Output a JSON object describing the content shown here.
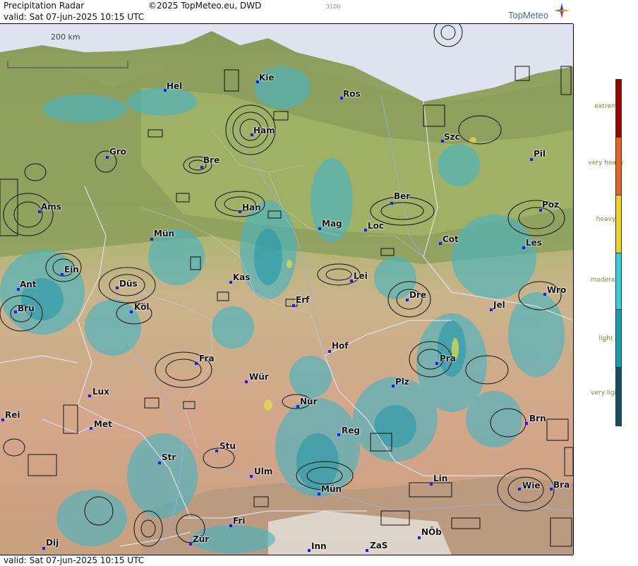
{
  "header": {
    "title": "Precipitation Radar",
    "copyright": "©2025 TopMeteo.eu, DWD",
    "small_code": "3100",
    "valid": "valid:  Sat  07-jun-2025 10:15 UTC",
    "logo": "TopMeteo",
    "compass_icon": "compass-rose-icon"
  },
  "footer": {
    "valid": "valid:  Sat  07-jun-2025 10:15 UTC"
  },
  "scale_bar": {
    "label": "200 km"
  },
  "legend": {
    "items": [
      {
        "label": "extrem",
        "color": "#a00000"
      },
      {
        "label": "very heavy",
        "color": "#e8641e"
      },
      {
        "label": "heavy",
        "color": "#f0d21e"
      },
      {
        "label": "moderate",
        "color": "#32d2dc"
      },
      {
        "label": "light",
        "color": "#14a0b4"
      },
      {
        "label": "very light",
        "color": "#145064"
      }
    ]
  },
  "cities": [
    {
      "name": "Hel"
    },
    {
      "name": "Kie"
    },
    {
      "name": "Ros"
    },
    {
      "name": "Ham"
    },
    {
      "name": "Szc"
    },
    {
      "name": "Gro"
    },
    {
      "name": "Bre"
    },
    {
      "name": "Pil"
    },
    {
      "name": "Ams"
    },
    {
      "name": "Han"
    },
    {
      "name": "Ber"
    },
    {
      "name": "Poz"
    },
    {
      "name": "Mün"
    },
    {
      "name": "Mag"
    },
    {
      "name": "Loc"
    },
    {
      "name": "Cot"
    },
    {
      "name": "Les"
    },
    {
      "name": "Ein"
    },
    {
      "name": "Kas"
    },
    {
      "name": "Lei"
    },
    {
      "name": "Ant"
    },
    {
      "name": "Düs"
    },
    {
      "name": "Dre"
    },
    {
      "name": "Wro"
    },
    {
      "name": "Bru"
    },
    {
      "name": "Köl"
    },
    {
      "name": "Erf"
    },
    {
      "name": "Jel"
    },
    {
      "name": "Hof"
    },
    {
      "name": "Fra"
    },
    {
      "name": "Pra"
    },
    {
      "name": "Wür"
    },
    {
      "name": "Plz"
    },
    {
      "name": "Lux"
    },
    {
      "name": "Nür"
    },
    {
      "name": "Rei"
    },
    {
      "name": "Met"
    },
    {
      "name": "Reg"
    },
    {
      "name": "Brn"
    },
    {
      "name": "Stu"
    },
    {
      "name": "Str"
    },
    {
      "name": "Ulm"
    },
    {
      "name": "Lin"
    },
    {
      "name": "Mün"
    },
    {
      "name": "Wie"
    },
    {
      "name": "Bra"
    },
    {
      "name": "Fri"
    },
    {
      "name": "NÖb"
    },
    {
      "name": "Zür"
    },
    {
      "name": "Dij"
    },
    {
      "name": "Inn"
    },
    {
      "name": "ZaS"
    }
  ]
}
